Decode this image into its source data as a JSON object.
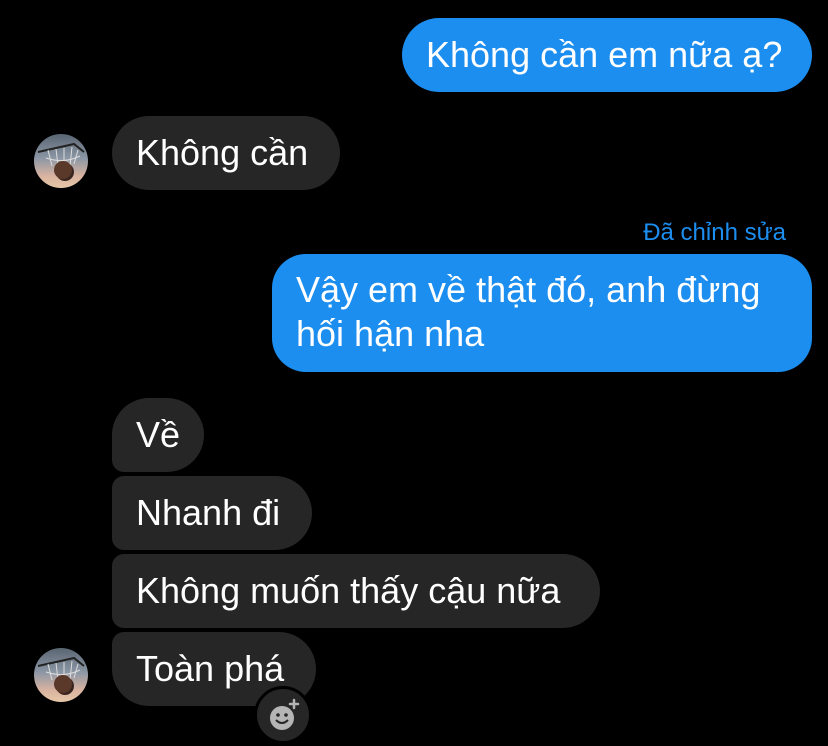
{
  "messages": [
    {
      "sender": "me",
      "text": "Không cần em nữa ạ?"
    },
    {
      "sender": "them",
      "text": "Không cần"
    },
    {
      "sender": "me",
      "edited_label": "Đã chỉnh sửa",
      "lines": [
        "Vậy em về thật đó, anh đừng",
        "hối hận nha"
      ]
    },
    {
      "sender": "them",
      "text": "Về"
    },
    {
      "sender": "them",
      "text": "Nhanh đi"
    },
    {
      "sender": "them",
      "text": "Không muốn thấy cậu nữa"
    },
    {
      "sender": "them",
      "text": "Toàn phá"
    }
  ],
  "colors": {
    "background": "#000000",
    "outgoing_bubble": "#1c8ef0",
    "incoming_bubble": "#262626",
    "edited_label": "#1c8ef0",
    "text": "#ffffff"
  },
  "icons": {
    "avatar": "contact-avatar",
    "reaction": "add-reaction-icon"
  }
}
